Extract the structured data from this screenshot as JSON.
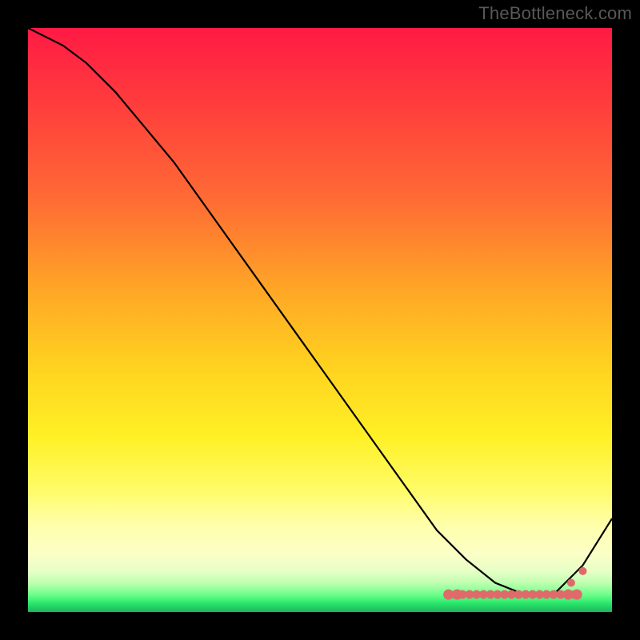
{
  "watermark": "TheBottleneck.com",
  "chart_data": {
    "type": "line",
    "title": "",
    "xlabel": "",
    "ylabel": "",
    "xlim": [
      0,
      100
    ],
    "ylim": [
      0,
      100
    ],
    "series": [
      {
        "name": "curve",
        "x": [
          0,
          6,
          10,
          15,
          20,
          25,
          30,
          35,
          40,
          45,
          50,
          55,
          60,
          65,
          70,
          75,
          80,
          85,
          90,
          95,
          100
        ],
        "values": [
          100,
          97,
          94,
          89,
          83,
          77,
          70,
          63,
          56,
          49,
          42,
          35,
          28,
          21,
          14,
          9,
          5,
          3,
          3,
          8,
          16
        ]
      }
    ],
    "dot_band": {
      "comment": "cluster of pink marker dots sitting on the flat bottom of the curve",
      "x_start": 72,
      "x_end": 94,
      "y": 3
    },
    "extra_dots": [
      {
        "x": 93,
        "y": 5
      },
      {
        "x": 95,
        "y": 7
      }
    ],
    "gradient_stops": [
      {
        "pct": 0,
        "color": "#ff1a44"
      },
      {
        "pct": 45,
        "color": "#ffa726"
      },
      {
        "pct": 70,
        "color": "#fff026"
      },
      {
        "pct": 90,
        "color": "#fcffc6"
      },
      {
        "pct": 100,
        "color": "#1db45a"
      }
    ]
  }
}
